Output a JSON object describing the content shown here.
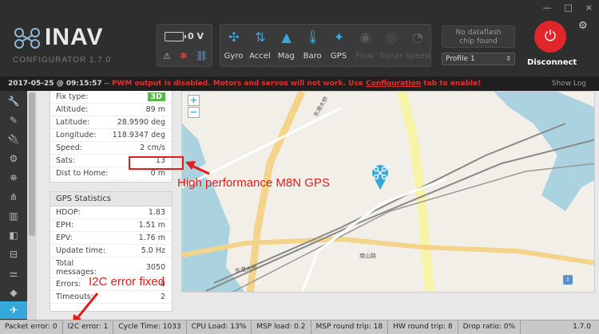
{
  "window": {
    "minimize": "—",
    "maximize": "□",
    "close": "×"
  },
  "header": {
    "logo_text": "INAV",
    "logo_sub": "CONFIGURATOR  1.7.0",
    "battery_voltage": "0 V",
    "sensors": [
      {
        "label": "Gyro",
        "icon": "gyro-icon",
        "active": true
      },
      {
        "label": "Accel",
        "icon": "accel-icon",
        "active": true
      },
      {
        "label": "Mag",
        "icon": "mag-icon",
        "active": true
      },
      {
        "label": "Baro",
        "icon": "baro-icon",
        "active": true
      },
      {
        "label": "GPS",
        "icon": "gps-icon",
        "active": true
      },
      {
        "label": "Flow",
        "icon": "flow-icon",
        "active": false
      },
      {
        "label": "Sonar",
        "icon": "sonar-icon",
        "active": false
      },
      {
        "label": "Speed",
        "icon": "speed-icon",
        "active": false
      }
    ],
    "dataflash_line1": "No dataflash",
    "dataflash_line2": "chip found",
    "profile_value": "Profile 1",
    "disconnect_label": "Disconnect"
  },
  "log": {
    "date": "2017-05-25 @ 09:15:57",
    "separator": " -- ",
    "warning": "PWM output is disabled. Motors and servos will not work. Use ",
    "link": "Configuration",
    "warning_tail": " tab to enable!",
    "show_log": "Show Log"
  },
  "gps": {
    "rows": [
      {
        "key": "Fix type:",
        "value": "3D"
      },
      {
        "key": "Altitude:",
        "value": "89 m"
      },
      {
        "key": "Latitude:",
        "value": "28.9590 deg"
      },
      {
        "key": "Longitude:",
        "value": "118.9347 deg"
      },
      {
        "key": "Speed:",
        "value": "2 cm/s"
      },
      {
        "key": "Sats:",
        "value": "13"
      },
      {
        "key": "Dist to Home:",
        "value": "0 m"
      }
    ]
  },
  "stats": {
    "title": "GPS Statistics",
    "rows": [
      {
        "key": "HDOP:",
        "value": "1.83"
      },
      {
        "key": "EPH:",
        "value": "1.51 m"
      },
      {
        "key": "EPV:",
        "value": "1.76 m"
      },
      {
        "key": "Update time:",
        "value": "5.0 Hz"
      },
      {
        "key": "Total messages:",
        "value": "3050"
      },
      {
        "key": "Errors:",
        "value": "0"
      },
      {
        "key": "Timeouts:",
        "value": "2"
      }
    ]
  },
  "map": {
    "zoom_in": "+",
    "zoom_out": "−",
    "info": "i",
    "labels": [
      "东港大桥",
      "东港大桥",
      "南山路"
    ]
  },
  "annotations": {
    "gps_note": "High performance M8N GPS",
    "i2c_note": "I2C error  fixed"
  },
  "status": {
    "items": [
      "Packet error: 0",
      "I2C error: 1",
      "Cycle Time: 1033",
      "CPU Load: 13%",
      "MSP load: 0.2",
      "MSP round trip: 18",
      "HW round trip: 8",
      "Drop ratio: 0%"
    ],
    "version": "1.7.0"
  },
  "colors": {
    "accent": "#37a8db",
    "disconnect": "#e0262b",
    "warning": "#e03030",
    "annotation": "#e01c1c",
    "fix_badge": "#56b948"
  }
}
